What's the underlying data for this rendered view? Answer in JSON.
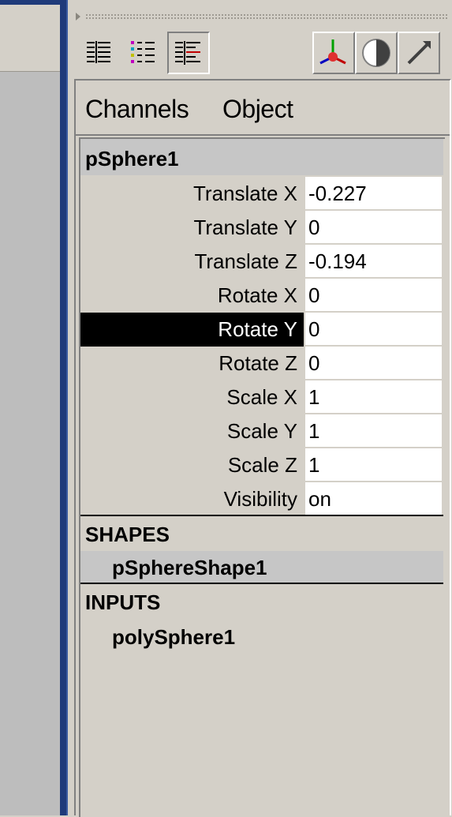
{
  "menu": {
    "channels": "Channels",
    "object": "Object"
  },
  "toolbar": {
    "buttons": [
      "channel-list-icon",
      "attribute-list-icon",
      "channel-box-icon"
    ],
    "right_buttons": [
      "manipulator-icon",
      "shading-icon",
      "arrow-icon"
    ]
  },
  "object": {
    "name": "pSphere1",
    "attributes": [
      {
        "label": "Translate X",
        "value": "-0.227",
        "selected": false
      },
      {
        "label": "Translate Y",
        "value": "0",
        "selected": false
      },
      {
        "label": "Translate Z",
        "value": "-0.194",
        "selected": false
      },
      {
        "label": "Rotate X",
        "value": "0",
        "selected": false
      },
      {
        "label": "Rotate Y",
        "value": "0",
        "selected": true
      },
      {
        "label": "Rotate Z",
        "value": "0",
        "selected": false
      },
      {
        "label": "Scale X",
        "value": "1",
        "selected": false
      },
      {
        "label": "Scale Y",
        "value": "1",
        "selected": false
      },
      {
        "label": "Scale Z",
        "value": "1",
        "selected": false
      },
      {
        "label": "Visibility",
        "value": "on",
        "selected": false
      }
    ]
  },
  "shapes": {
    "title": "SHAPES",
    "items": [
      "pSphereShape1"
    ]
  },
  "inputs": {
    "title": "INPUTS",
    "items": [
      "polySphere1"
    ]
  }
}
